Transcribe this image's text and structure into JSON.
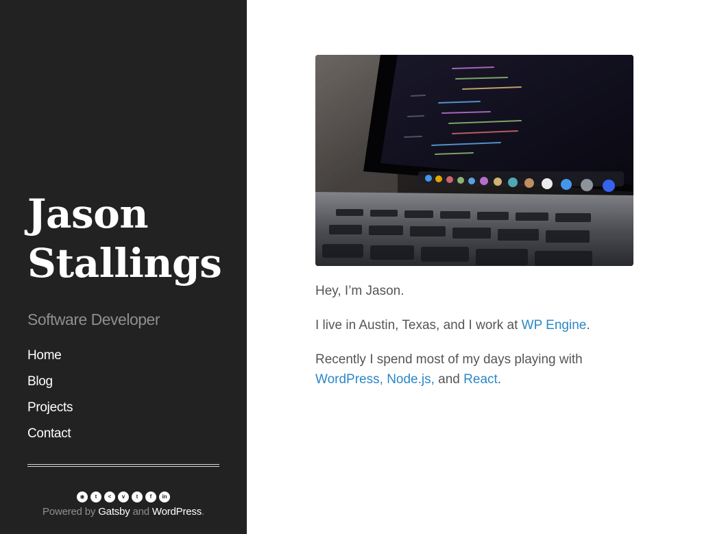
{
  "sidebar": {
    "title_line1": "Jason",
    "title_line2": "Stallings",
    "tagline": "Software Developer",
    "nav": [
      {
        "label": "Home"
      },
      {
        "label": "Blog"
      },
      {
        "label": "Projects"
      },
      {
        "label": "Contact"
      }
    ],
    "social": [
      {
        "icon": "github-icon",
        "glyph": "◉"
      },
      {
        "icon": "twitter-icon",
        "glyph": "t"
      },
      {
        "icon": "share-icon",
        "glyph": "<"
      },
      {
        "icon": "vimeo-icon",
        "glyph": "v"
      },
      {
        "icon": "tumblr-icon",
        "glyph": "t"
      },
      {
        "icon": "facebook-icon",
        "glyph": "f"
      },
      {
        "icon": "linkedin-icon",
        "glyph": "in"
      }
    ],
    "powered": {
      "prefix": "Powered by ",
      "gatsby": "Gatsby",
      "and": " and ",
      "wordpress": "WordPress",
      "suffix": "."
    }
  },
  "main": {
    "hero_image_alt": "laptop showing code",
    "greeting": "Hey, I’m Jason.",
    "location_prefix": "I live in Austin, Texas, and I work at ",
    "employer_link": "WP Engine",
    "location_suffix": ".",
    "recent_prefix": "Recently I spend most of my days playing with ",
    "link_wordpress": "WordPress,",
    "link_node": "Node.js,",
    "and_text": " and ",
    "link_react": "React",
    "recent_suffix": "."
  },
  "colors": {
    "sidebar_bg": "#222222",
    "link": "#2a87c7",
    "body_text": "#555555",
    "muted": "#8f8f8f"
  }
}
